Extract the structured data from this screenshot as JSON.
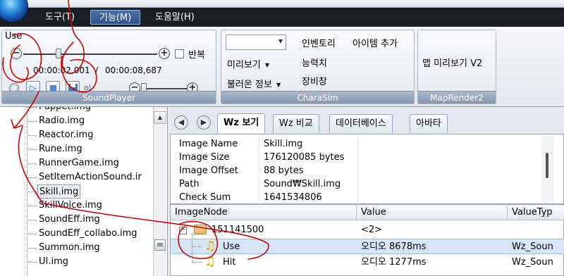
{
  "menu": {
    "items": [
      "도구(T)",
      "기능(M)",
      "도움말(H)"
    ],
    "active_index": 1
  },
  "ribbon": {
    "sound_player": {
      "use_label": "Use",
      "repeat_label": "반복",
      "current_time": "00:00:02,001",
      "separator": "/",
      "total_time": "00:00:08,687",
      "volume_text": "ol",
      "group_label": "SoundPlayer"
    },
    "charasim": {
      "preview_label": "미리보기",
      "load_info_label": "불러온 정보",
      "inventory_label": "인벤토리",
      "add_item_label": "아이템 추가",
      "stats_label": "능력치",
      "equipment_label": "장비창",
      "group_label": "CharaSim"
    },
    "maprender": {
      "map_preview_label": "맵 미리보기 V2",
      "group_label": "MapRender2"
    }
  },
  "tree": {
    "items": [
      "Puppet.img",
      "Radio.img",
      "Reactor.img",
      "Rune.img",
      "RunnerGame.img",
      "SetItemActionSound.ir",
      "Skill.img",
      "SkillVoice.img",
      "SoundEff.img",
      "SoundEff_collabo.img",
      "Summon.img",
      "UI.img"
    ],
    "selected": "Skill.img"
  },
  "tabs": {
    "items": [
      "Wz 보기",
      "Wz 비교",
      "데이터베이스",
      "아바타"
    ],
    "active_index": 0
  },
  "properties": [
    {
      "name": "Image Name",
      "value": "Skill.img"
    },
    {
      "name": "Image Size",
      "value": "176120085 bytes"
    },
    {
      "name": "Image Offset",
      "value": "88 bytes"
    },
    {
      "name": "Path",
      "value": "Sound₩Skill.img"
    },
    {
      "name": "Check Sum",
      "value": "1641534806"
    }
  ],
  "node_grid": {
    "headers": [
      "ImageNode",
      "Value",
      "ValueTyp"
    ],
    "rows": [
      {
        "node": "151141500",
        "value": "<2>",
        "type": "",
        "kind": "folder"
      },
      {
        "node": "Use",
        "value": "오디오  8678ms",
        "type": "Wz_Soun",
        "kind": "sound",
        "selected": true
      },
      {
        "node": "Hit",
        "value": "오디오  1277ms",
        "type": "Wz_Soun",
        "kind": "sound"
      }
    ]
  },
  "colors": {
    "menubar": "#1b1e23",
    "ribbon_footer": "#8ea1b9",
    "selection": "#d6e6f7",
    "annotation": "#d40000"
  }
}
